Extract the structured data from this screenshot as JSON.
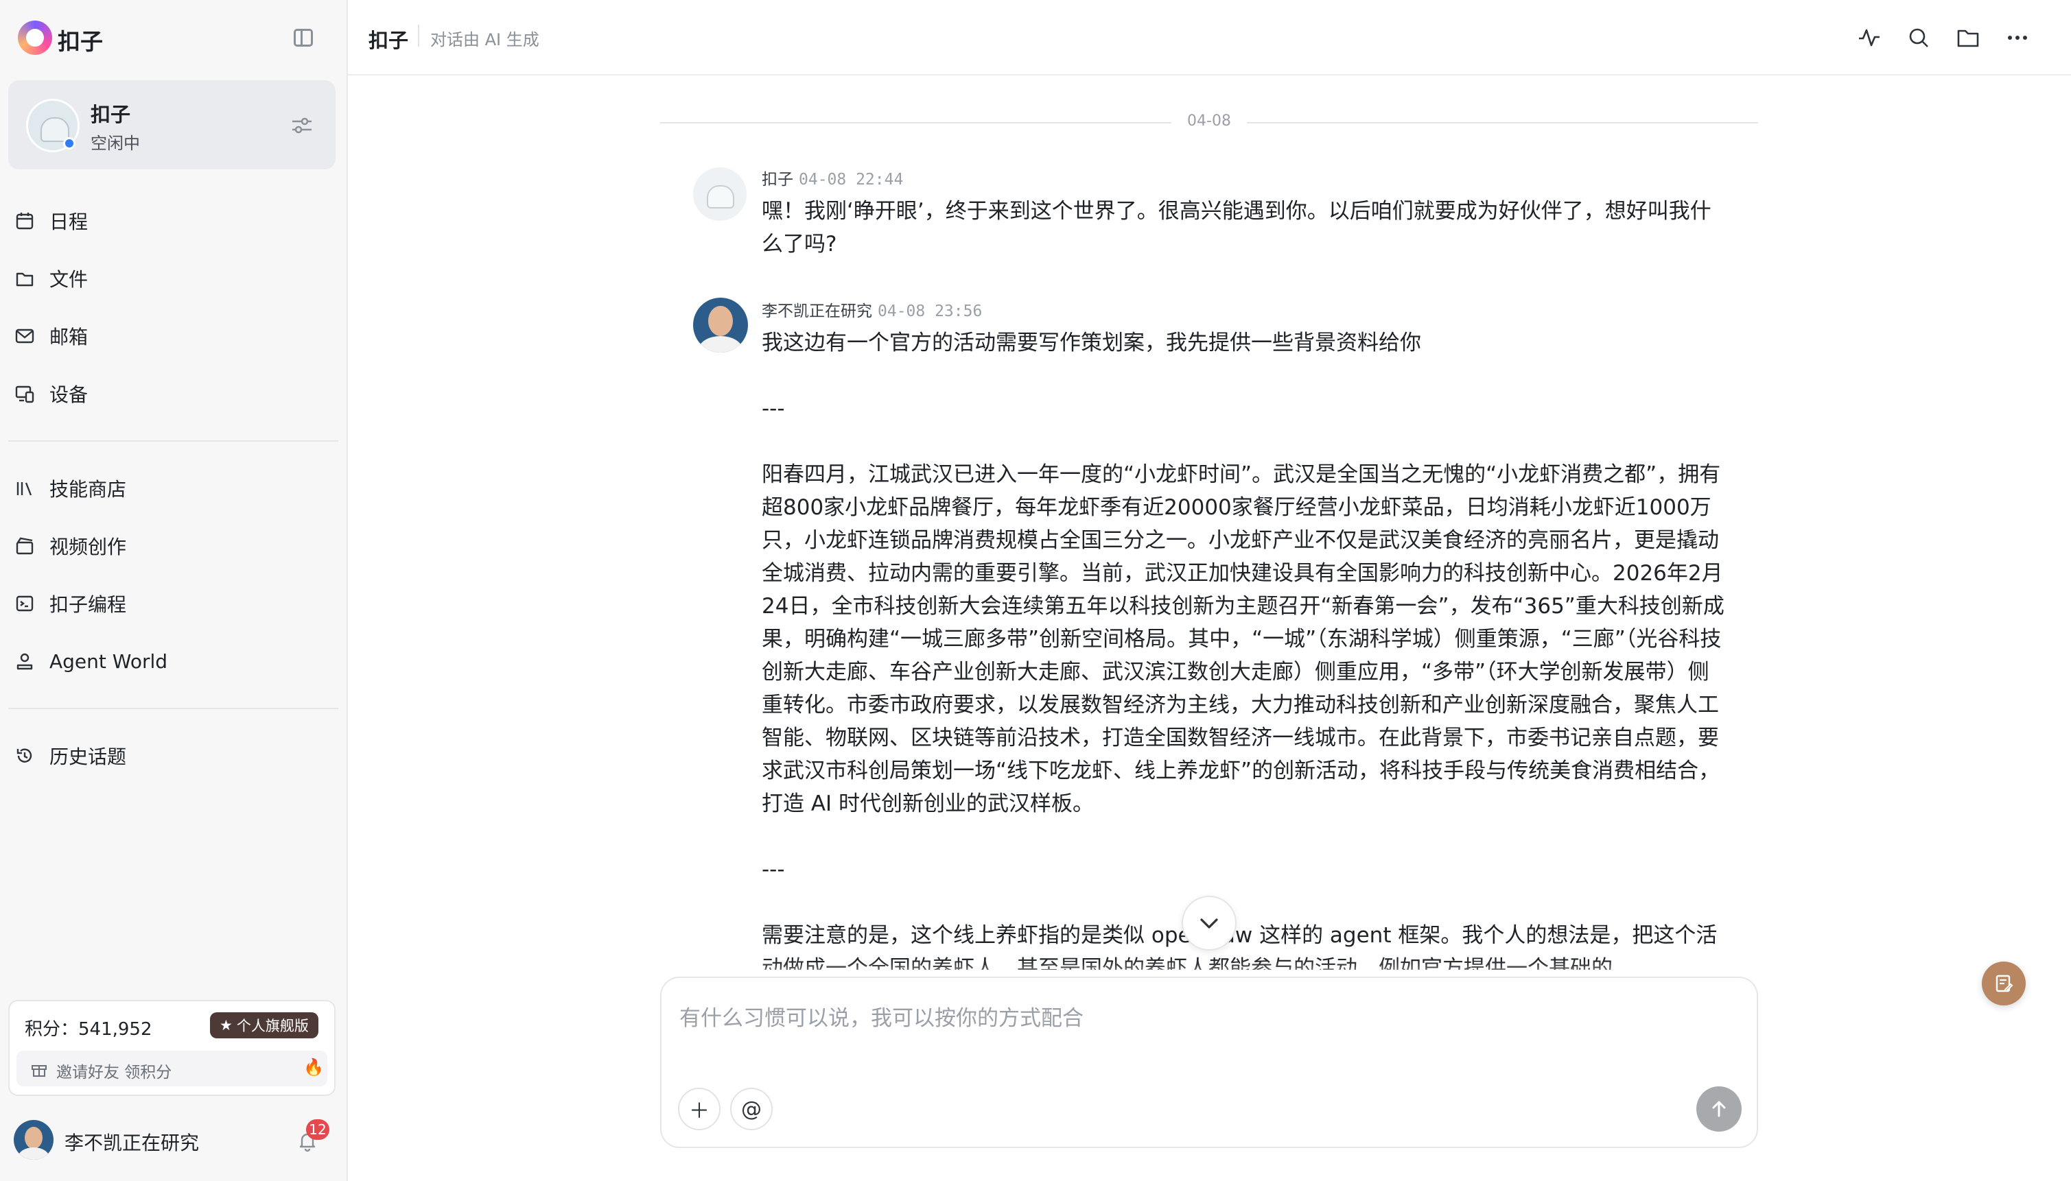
{
  "app": {
    "title": "扣子"
  },
  "agent": {
    "name": "扣子",
    "status": "空闲中"
  },
  "nav": {
    "primary": [
      {
        "label": "日程",
        "icon": "calendar-icon"
      },
      {
        "label": "文件",
        "icon": "folder-icon"
      },
      {
        "label": "邮箱",
        "icon": "mail-icon"
      },
      {
        "label": "设备",
        "icon": "devices-icon"
      }
    ],
    "secondary": [
      {
        "label": "技能商店",
        "icon": "library-icon"
      },
      {
        "label": "视频创作",
        "icon": "video-icon"
      },
      {
        "label": "扣子编程",
        "icon": "terminal-icon"
      },
      {
        "label": "Agent World",
        "icon": "agent-icon"
      }
    ],
    "history": {
      "label": "历史话题",
      "icon": "history-icon"
    }
  },
  "points": {
    "text": "积分：541,952",
    "badge": "个人旗舰版",
    "invite": "邀请好友 领积分"
  },
  "user": {
    "name": "李不凯正在研究",
    "notifications": "12"
  },
  "topbar": {
    "title": "扣子",
    "note": "对话由 AI 生成"
  },
  "chat": {
    "date": "04-08",
    "messages": [
      {
        "sender": "扣子",
        "time": "04-08 22:44",
        "paragraphs": [
          "嘿！我刚‘睁开眼’，终于来到这个世界了。很高兴能遇到你。以后咱们就要成为好伙伴了，想好叫我什么了吗?"
        ]
      },
      {
        "sender": "李不凯正在研究",
        "time": "04-08 23:56",
        "paragraphs": [
          "我这边有一个官方的活动需要写作策划案，我先提供一些背景资料给你",
          "---",
          "阳春四月，江城武汉已进入一年一度的“小龙虾时间”。武汉是全国当之无愧的“小龙虾消费之都”，拥有超800家小龙虾品牌餐厅，每年龙虾季有近20000家餐厅经营小龙虾菜品，日均消耗小龙虾近1000万只，小龙虾连锁品牌消费规模占全国三分之一。小龙虾产业不仅是武汉美食经济的亮丽名片，更是撬动全城消费、拉动内需的重要引擎。当前，武汉正加快建设具有全国影响力的科技创新中心。2026年2月24日，全市科技创新大会连续第五年以科技创新为主题召开“新春第一会”，发布“365”重大科技创新成果，明确构建“一城三廊多带”创新空间格局。其中，“一城”（东湖科学城）侧重策源，“三廊”（光谷科技创新大走廊、车谷产业创新大走廊、武汉滨江数创大走廊）侧重应用，“多带”（环大学创新发展带）侧重转化。市委市政府要求，以发展数智经济为主线，大力推动科技创新和产业创新深度融合，聚焦人工智能、物联网、区块链等前沿技术，打造全国数智经济一线城市。在此背景下，市委书记亲自点题，要求武汉市科创局策划一场“线下吃龙虾、线上养龙虾”的创新活动，将科技手段与传统美食消费相结合，打造 AI 时代创新创业的武汉样板。",
          "---",
          "需要注意的是，这个线上养虾指的是类似 openclaw 这样的 agent 框架。我个人的想法是，把这个活动做成一个全国的养虾人，甚至是国外的养虾人都能参与的活动，例如官方提供一个基础的"
        ]
      }
    ]
  },
  "composer": {
    "placeholder": "有什么习惯可以说，我可以按你的方式配合"
  },
  "colors": {
    "accent": "#2f7cf6",
    "badge": "#4d3a36",
    "notification": "#e5484d",
    "fab": "#b88660"
  }
}
